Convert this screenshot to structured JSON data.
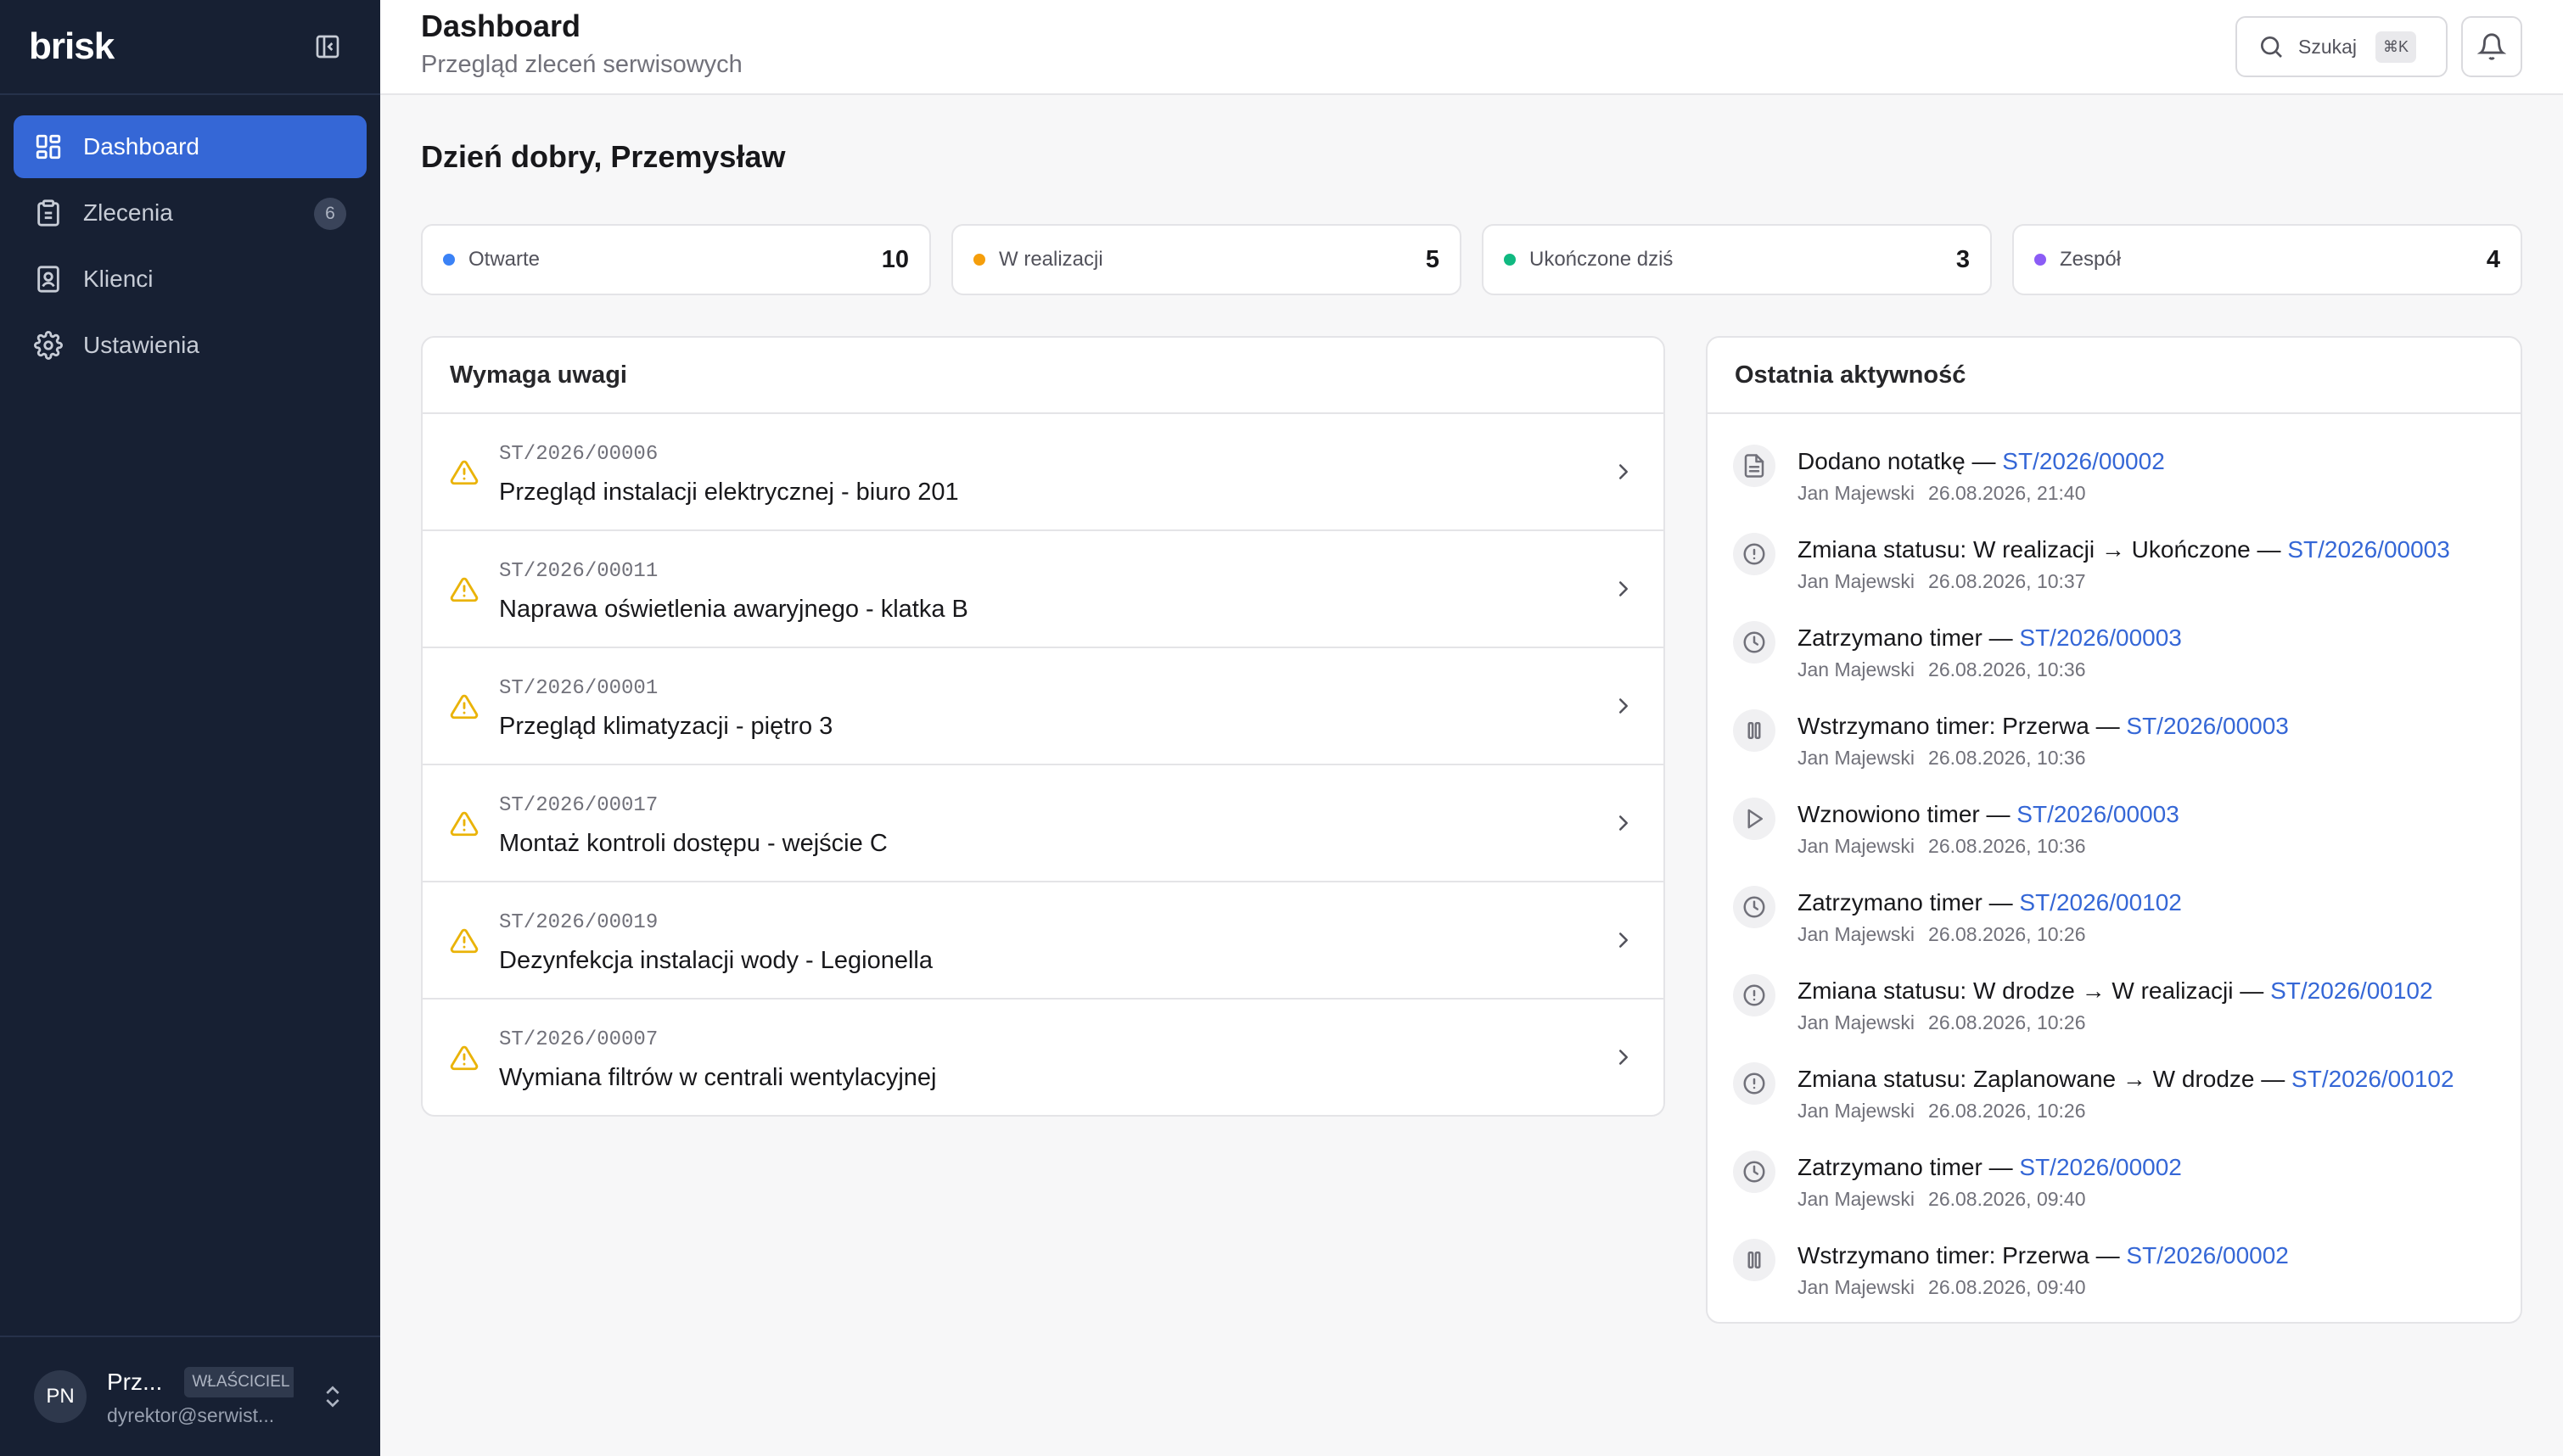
{
  "app": {
    "logo": "brisk"
  },
  "sidebar": {
    "items": [
      {
        "label": "Dashboard",
        "icon": "layout-grid-icon",
        "active": true
      },
      {
        "label": "Zlecenia",
        "icon": "clipboard-icon",
        "badge": "6"
      },
      {
        "label": "Klienci",
        "icon": "contact-icon"
      },
      {
        "label": "Ustawienia",
        "icon": "gear-icon"
      }
    ],
    "user": {
      "initials": "PN",
      "name": "Prz...",
      "role": "WŁAŚCICIEL",
      "email": "dyrektor@serwist..."
    }
  },
  "header": {
    "title": "Dashboard",
    "subtitle": "Przegląd zleceń serwisowych",
    "search_label": "Szukaj",
    "search_shortcut": "⌘K"
  },
  "greeting": "Dzień dobry, Przemysław",
  "stats": [
    {
      "label": "Otwarte",
      "value": "10",
      "color": "#3b82f6"
    },
    {
      "label": "W realizacji",
      "value": "5",
      "color": "#f59e0b"
    },
    {
      "label": "Ukończone dziś",
      "value": "3",
      "color": "#10b981"
    },
    {
      "label": "Zespół",
      "value": "4",
      "color": "#8b5cf6"
    }
  ],
  "attention": {
    "title": "Wymaga uwagi",
    "items": [
      {
        "id": "ST/2026/00006",
        "title": "Przegląd instalacji elektrycznej - biuro 201"
      },
      {
        "id": "ST/2026/00011",
        "title": "Naprawa oświetlenia awaryjnego - klatka B"
      },
      {
        "id": "ST/2026/00001",
        "title": "Przegląd klimatyzacji - piętro 3"
      },
      {
        "id": "ST/2026/00017",
        "title": "Montaż kontroli dostępu - wejście C"
      },
      {
        "id": "ST/2026/00019",
        "title": "Dezynfekcja instalacji wody - Legionella"
      },
      {
        "id": "ST/2026/00007",
        "title": "Wymiana filtrów w centrali wentylacyjnej"
      }
    ]
  },
  "activity": {
    "title": "Ostatnia aktywność",
    "items": [
      {
        "icon": "note-icon",
        "text": "Dodano notatkę —",
        "ref": "ST/2026/00002",
        "user": "Jan Majewski",
        "time": "26.08.2026, 21:40"
      },
      {
        "icon": "status-icon",
        "text": "Zmiana statusu: W realizacji → Ukończone —",
        "ref": "ST/2026/00003",
        "user": "Jan Majewski",
        "time": "26.08.2026, 10:37"
      },
      {
        "icon": "clock-icon",
        "text": "Zatrzymano timer —",
        "ref": "ST/2026/00003",
        "user": "Jan Majewski",
        "time": "26.08.2026, 10:36"
      },
      {
        "icon": "pause-icon",
        "text": "Wstrzymano timer: Przerwa —",
        "ref": "ST/2026/00003",
        "user": "Jan Majewski",
        "time": "26.08.2026, 10:36"
      },
      {
        "icon": "play-icon",
        "text": "Wznowiono timer —",
        "ref": "ST/2026/00003",
        "user": "Jan Majewski",
        "time": "26.08.2026, 10:36"
      },
      {
        "icon": "clock-icon",
        "text": "Zatrzymano timer —",
        "ref": "ST/2026/00102",
        "user": "Jan Majewski",
        "time": "26.08.2026, 10:26"
      },
      {
        "icon": "status-icon",
        "text": "Zmiana statusu: W drodze → W realizacji —",
        "ref": "ST/2026/00102",
        "user": "Jan Majewski",
        "time": "26.08.2026, 10:26"
      },
      {
        "icon": "status-icon",
        "text": "Zmiana statusu: Zaplanowane → W drodze —",
        "ref": "ST/2026/00102",
        "user": "Jan Majewski",
        "time": "26.08.2026, 10:26"
      },
      {
        "icon": "clock-icon",
        "text": "Zatrzymano timer —",
        "ref": "ST/2026/00002",
        "user": "Jan Majewski",
        "time": "26.08.2026, 09:40"
      },
      {
        "icon": "pause-icon",
        "text": "Wstrzymano timer: Przerwa —",
        "ref": "ST/2026/00002",
        "user": "Jan Majewski",
        "time": "26.08.2026, 09:40"
      }
    ]
  }
}
